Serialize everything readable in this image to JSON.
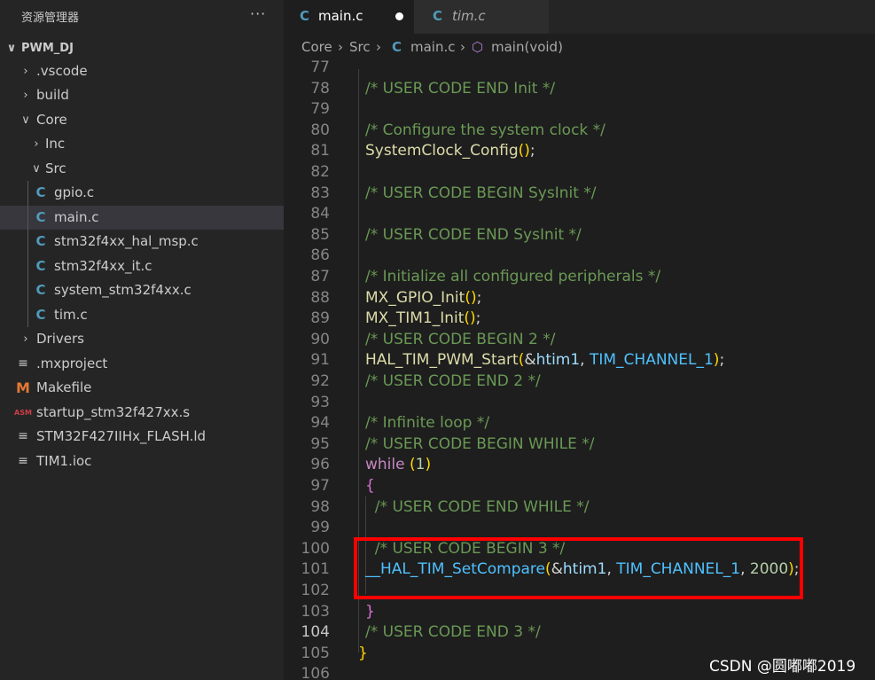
{
  "explorer": {
    "title": "资源管理器",
    "more": "···",
    "items": [
      {
        "label": "PWM_DJ",
        "chevron": "∨",
        "icon": "",
        "icon_kind": "none",
        "selected": false,
        "bold": true
      },
      {
        "label": ".vscode",
        "chevron": "›",
        "icon": "",
        "icon_kind": "none",
        "selected": false
      },
      {
        "label": "build",
        "chevron": "›",
        "icon": "",
        "icon_kind": "none",
        "selected": false
      },
      {
        "label": "Core",
        "chevron": "∨",
        "icon": "",
        "icon_kind": "none",
        "selected": false
      },
      {
        "label": "Inc",
        "chevron": "›",
        "icon": "",
        "icon_kind": "none",
        "selected": false
      },
      {
        "label": "Src",
        "chevron": "∨",
        "icon": "",
        "icon_kind": "none",
        "selected": false
      },
      {
        "label": "gpio.c",
        "chevron": "",
        "icon": "C",
        "icon_kind": "c",
        "selected": false
      },
      {
        "label": "main.c",
        "chevron": "",
        "icon": "C",
        "icon_kind": "c",
        "selected": true
      },
      {
        "label": "stm32f4xx_hal_msp.c",
        "chevron": "",
        "icon": "C",
        "icon_kind": "c",
        "selected": false
      },
      {
        "label": "stm32f4xx_it.c",
        "chevron": "",
        "icon": "C",
        "icon_kind": "c",
        "selected": false
      },
      {
        "label": "system_stm32f4xx.c",
        "chevron": "",
        "icon": "C",
        "icon_kind": "c",
        "selected": false
      },
      {
        "label": "tim.c",
        "chevron": "",
        "icon": "C",
        "icon_kind": "c",
        "selected": false
      },
      {
        "label": "Drivers",
        "chevron": "›",
        "icon": "",
        "icon_kind": "none",
        "selected": false
      },
      {
        "label": ".mxproject",
        "chevron": "",
        "icon": "≡",
        "icon_kind": "lines",
        "selected": false
      },
      {
        "label": "Makefile",
        "chevron": "",
        "icon": "M",
        "icon_kind": "m",
        "selected": false
      },
      {
        "label": "startup_stm32f427xx.s",
        "chevron": "",
        "icon": "ASM",
        "icon_kind": "asm",
        "selected": false
      },
      {
        "label": "STM32F427IIHx_FLASH.ld",
        "chevron": "",
        "icon": "≡",
        "icon_kind": "lines",
        "selected": false
      },
      {
        "label": "TIM1.ioc",
        "chevron": "",
        "icon": "≡",
        "icon_kind": "lines",
        "selected": false
      }
    ]
  },
  "tabs": [
    {
      "icon": "C",
      "label": "main.c",
      "active": true,
      "dirty": true
    },
    {
      "icon": "C",
      "label": "tim.c",
      "active": false,
      "dirty": false
    }
  ],
  "breadcrumb": {
    "parts": [
      "Core",
      "Src"
    ],
    "file_icon": "C",
    "file": "main.c",
    "symbol_icon": "⬡",
    "symbol": "main(void)",
    "separator": "›"
  },
  "editor": {
    "current_line": 104,
    "lines": [
      {
        "n": 77,
        "tokens": []
      },
      {
        "n": 78,
        "tokens": [
          {
            "t": "/* USER CODE END Init */",
            "c": "cmt"
          }
        ]
      },
      {
        "n": 79,
        "tokens": []
      },
      {
        "n": 80,
        "tokens": [
          {
            "t": "/* Configure the system clock */",
            "c": "cmt"
          }
        ]
      },
      {
        "n": 81,
        "tokens": [
          {
            "t": "SystemClock_Config",
            "c": "fn"
          },
          {
            "t": "()",
            "c": "br2"
          },
          {
            "t": ";",
            "c": "plain"
          }
        ]
      },
      {
        "n": 82,
        "tokens": []
      },
      {
        "n": 83,
        "tokens": [
          {
            "t": "/* USER CODE BEGIN SysInit */",
            "c": "cmt"
          }
        ]
      },
      {
        "n": 84,
        "tokens": []
      },
      {
        "n": 85,
        "tokens": [
          {
            "t": "/* USER CODE END SysInit */",
            "c": "cmt"
          }
        ]
      },
      {
        "n": 86,
        "tokens": []
      },
      {
        "n": 87,
        "tokens": [
          {
            "t": "/* Initialize all configured peripherals */",
            "c": "cmt"
          }
        ]
      },
      {
        "n": 88,
        "tokens": [
          {
            "t": "MX_GPIO_Init",
            "c": "fn"
          },
          {
            "t": "()",
            "c": "br2"
          },
          {
            "t": ";",
            "c": "plain"
          }
        ]
      },
      {
        "n": 89,
        "tokens": [
          {
            "t": "MX_TIM1_Init",
            "c": "fn"
          },
          {
            "t": "()",
            "c": "br2"
          },
          {
            "t": ";",
            "c": "plain"
          }
        ]
      },
      {
        "n": 90,
        "tokens": [
          {
            "t": "/* USER CODE BEGIN 2 */",
            "c": "cmt"
          }
        ]
      },
      {
        "n": 91,
        "tokens": [
          {
            "t": "HAL_TIM_PWM_Start",
            "c": "fn"
          },
          {
            "t": "(",
            "c": "br2"
          },
          {
            "t": "&",
            "c": "plain"
          },
          {
            "t": "htim1",
            "c": "var"
          },
          {
            "t": ", ",
            "c": "plain"
          },
          {
            "t": "TIM_CHANNEL_1",
            "c": "cst"
          },
          {
            "t": ")",
            "c": "br2"
          },
          {
            "t": ";",
            "c": "plain"
          }
        ]
      },
      {
        "n": 92,
        "tokens": [
          {
            "t": "/* USER CODE END 2 */",
            "c": "cmt"
          }
        ]
      },
      {
        "n": 93,
        "tokens": []
      },
      {
        "n": 94,
        "tokens": [
          {
            "t": "/* Infinite loop */",
            "c": "cmt"
          }
        ]
      },
      {
        "n": 95,
        "tokens": [
          {
            "t": "/* USER CODE BEGIN WHILE */",
            "c": "cmt"
          }
        ]
      },
      {
        "n": 96,
        "tokens": [
          {
            "t": "while",
            "c": "kw"
          },
          {
            "t": " ",
            "c": "plain"
          },
          {
            "t": "(",
            "c": "br2"
          },
          {
            "t": "1",
            "c": "num"
          },
          {
            "t": ")",
            "c": "br2"
          }
        ]
      },
      {
        "n": 97,
        "tokens": [
          {
            "t": "{",
            "c": "br"
          }
        ]
      },
      {
        "n": 98,
        "tokens": [
          {
            "t": "  /* USER CODE END WHILE */",
            "c": "cmt"
          }
        ]
      },
      {
        "n": 99,
        "tokens": []
      },
      {
        "n": 100,
        "tokens": [
          {
            "t": "  /* USER CODE BEGIN 3 */",
            "c": "cmt"
          }
        ]
      },
      {
        "n": 101,
        "tokens": [
          {
            "t": "__HAL_TIM_SetCompare",
            "c": "cst"
          },
          {
            "t": "(",
            "c": "br2"
          },
          {
            "t": "&",
            "c": "plain"
          },
          {
            "t": "htim1",
            "c": "var"
          },
          {
            "t": ", ",
            "c": "plain"
          },
          {
            "t": "TIM_CHANNEL_1",
            "c": "cst"
          },
          {
            "t": ", ",
            "c": "plain"
          },
          {
            "t": "2000",
            "c": "num"
          },
          {
            "t": ")",
            "c": "br2"
          },
          {
            "t": ";",
            "c": "plain"
          }
        ]
      },
      {
        "n": 102,
        "tokens": []
      },
      {
        "n": 103,
        "tokens": [
          {
            "t": "}",
            "c": "br"
          }
        ]
      },
      {
        "n": 104,
        "tokens": [
          {
            "t": "/* USER CODE END 3 */",
            "c": "cmt"
          }
        ]
      },
      {
        "n": 105,
        "tokens": [
          {
            "t": "}",
            "c": "br2"
          }
        ]
      },
      {
        "n": 106,
        "tokens": []
      }
    ]
  },
  "colors": {
    "highlight_box": "#ff0000",
    "c_icon": "#519aba",
    "makefile_icon": "#e37933",
    "asm_icon": "#cc3e44"
  },
  "watermark": "CSDN @圆嘟嘟2019"
}
